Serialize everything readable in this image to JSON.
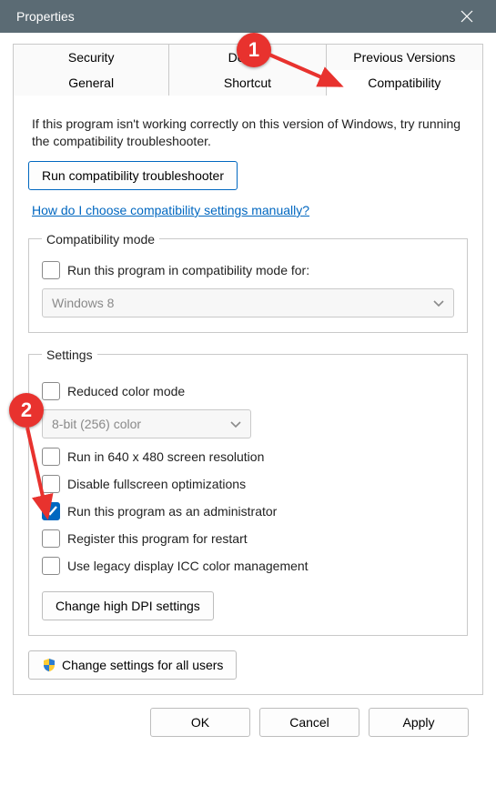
{
  "window": {
    "title": "Properties"
  },
  "tabs": {
    "row1": [
      "Security",
      "Details",
      "Previous Versions"
    ],
    "row2": [
      "General",
      "Shortcut",
      "Compatibility"
    ],
    "active": "Compatibility"
  },
  "intro": "If this program isn't working correctly on this version of Windows, try running the compatibility troubleshooter.",
  "buttons": {
    "troubleshooter": "Run compatibility troubleshooter",
    "dpi": "Change high DPI settings",
    "all_users": "Change settings for all users",
    "ok": "OK",
    "cancel": "Cancel",
    "apply": "Apply"
  },
  "link": "How do I choose compatibility settings manually?",
  "compat_mode": {
    "legend": "Compatibility mode",
    "checkbox": "Run this program in compatibility mode for:",
    "select": "Windows 8"
  },
  "settings": {
    "legend": "Settings",
    "reduced_color": "Reduced color mode",
    "color_select": "8-bit (256) color",
    "res_640": "Run in 640 x 480 screen resolution",
    "disable_fs": "Disable fullscreen optimizations",
    "run_admin": "Run this program as an administrator",
    "register_restart": "Register this program for restart",
    "legacy_icc": "Use legacy display ICC color management"
  },
  "annotations": {
    "one": "1",
    "two": "2"
  }
}
